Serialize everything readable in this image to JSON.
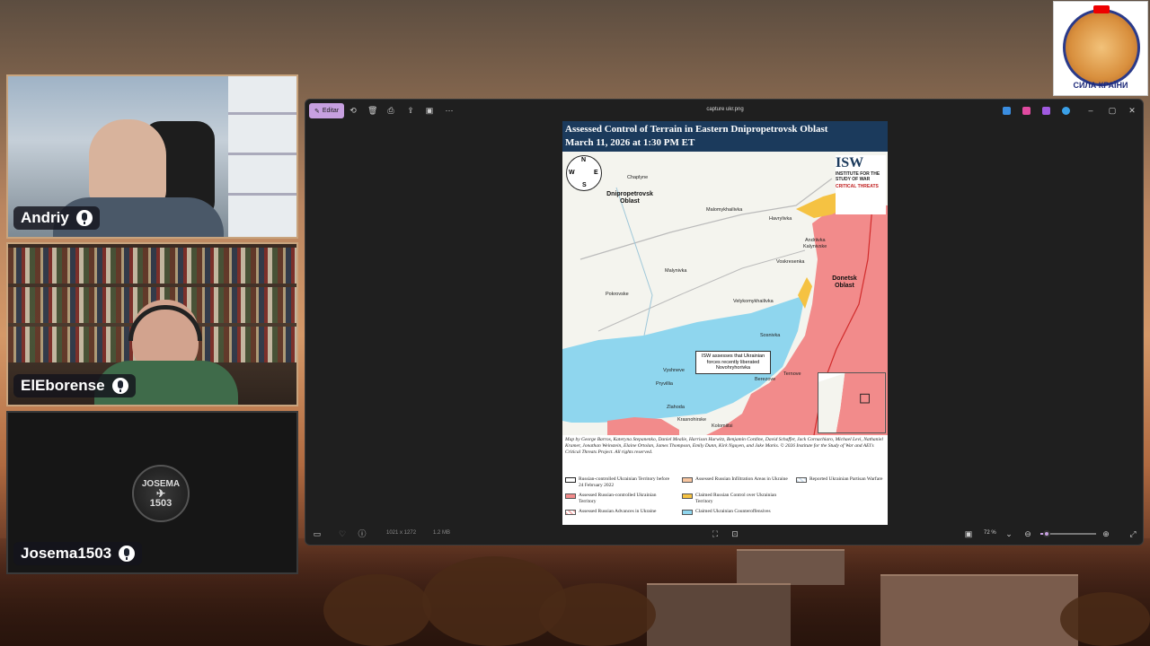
{
  "participants": [
    {
      "name": "Andriy",
      "mic": "microphone-icon"
    },
    {
      "name": "ElEborense",
      "mic": "microphone-icon"
    },
    {
      "name": "Josema1503",
      "mic": "microphone-icon",
      "avatar_text": "JOSEMA",
      "avatar_number": "1503"
    }
  ],
  "channel_logo": {
    "text": "СИЛА КРАЇНИ",
    "badge": "YouTube"
  },
  "window": {
    "edit_label": "Editar",
    "file_name": "capture ukr.png",
    "toolbar_icons": [
      "rotate-icon",
      "delete-icon",
      "print-icon",
      "share-icon",
      "slideshow-icon",
      "more-icon"
    ],
    "status": {
      "dimensions": "1021 x 1272",
      "size": "1.2 MB",
      "zoom": "72 %",
      "zoom_fraction": 0.12
    }
  },
  "map": {
    "title_line1": "Assessed Control of Terrain in Eastern Dnipropetrovsk Oblast",
    "title_line2": "March 11, 2026 at 1:30 PM ET",
    "oblast_west": "Dnipropetrovsk Oblast",
    "oblast_east": "Donetsk Oblast",
    "places": [
      "Chaplyne",
      "Malomykhailivka",
      "Havrylivka",
      "Andriivka",
      "Kalynivske",
      "Voskresenka",
      "Malynivka",
      "Pokrovske",
      "Velykomykhailivka",
      "Sosnivka",
      "Vyshneve",
      "Ternove",
      "Berezove",
      "Pryvillia",
      "Zlahoda",
      "Krasnohirske",
      "Kolomiitsi"
    ],
    "callout": "ISW assesses that Ukrainian forces recently liberated Novohryhorivka",
    "compass": {
      "n": "N",
      "s": "S",
      "e": "E",
      "w": "W"
    },
    "logo_primary": "ISW",
    "logo_secondary": "CRITICAL THREATS",
    "logo_sub": "INSTITUTE FOR THE STUDY OF WAR",
    "credits": "Map by George Barros, Kateryna Stepanenko, Daniel Mealie, Harrison Hurwitz, Benjamin Cordine, David Schaffer, Jack Cornachiaro, Michael Levi, Nathaniel Kramer, Jonathan Weinstein, Elaine Ortolan, James Thompson, Emily Dunn, Kirk Nguyen, and Jake Marks. © 2026 Institute for the Study of War and AEI's Critical Threats Project. All rights reserved.",
    "legend": [
      {
        "label": "Russian-controlled Ukrainian Territory before 24 February 2022",
        "color": "#ffffff"
      },
      {
        "label": "Assessed Russian Infiltration Areas in Ukraine",
        "color": "#f7c59f"
      },
      {
        "label": "Reported Ukrainian Partisan Warfare",
        "color": "#cfe0ee"
      },
      {
        "label": "Assessed Russian-controlled Ukrainian Territory",
        "color": "#f28b8b"
      },
      {
        "label": "Claimed Russian Control over Ukrainian Territory",
        "color": "#f5c242"
      },
      {
        "label": "Assessed Russian Advances in Ukraine",
        "color": "#f6b1b1"
      },
      {
        "label": "Claimed Ukrainian Counteroffensives",
        "color": "#8fd6ee"
      }
    ]
  }
}
